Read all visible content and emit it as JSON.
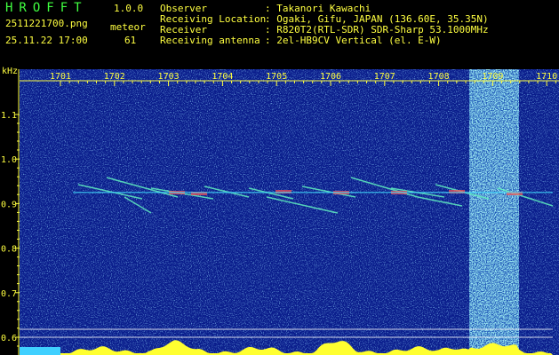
{
  "header": {
    "app_title": "HROFFT",
    "version": "1.0.0",
    "filename": "2511221700.png",
    "datetime": "25.11.22 17:00",
    "meteor_label": "meteor",
    "meteor_count": "61",
    "info": [
      {
        "label": "Observer",
        "value": ": Takanori Kawachi"
      },
      {
        "label": "Receiving Location",
        "value": ": Ogaki, Gifu, JAPAN (136.60E, 35.35N)"
      },
      {
        "label": "Receiver",
        "value": ": R820T2(RTL-SDR) SDR-Sharp 53.1000MHz"
      },
      {
        "label": "Receiving antenna",
        "value": ": 2el-HB9CV Vertical (el. E-W)"
      }
    ]
  },
  "spectrogram": {
    "y_unit": "kHz",
    "y_ticks": [
      "1.1",
      "1.0",
      "0.9",
      "0.8",
      "0.7",
      "0.6"
    ],
    "x_ticks": [
      "1701",
      "1702",
      "1703",
      "1704",
      "1705",
      "1706",
      "1707",
      "1708",
      "1709",
      "1710"
    ],
    "carrier_khz": 0.925,
    "colors": {
      "background": "#0a1d8c",
      "axis": "#ffff40",
      "carrier": "#40e0ff",
      "noise_band": "#3ad0ff"
    }
  }
}
